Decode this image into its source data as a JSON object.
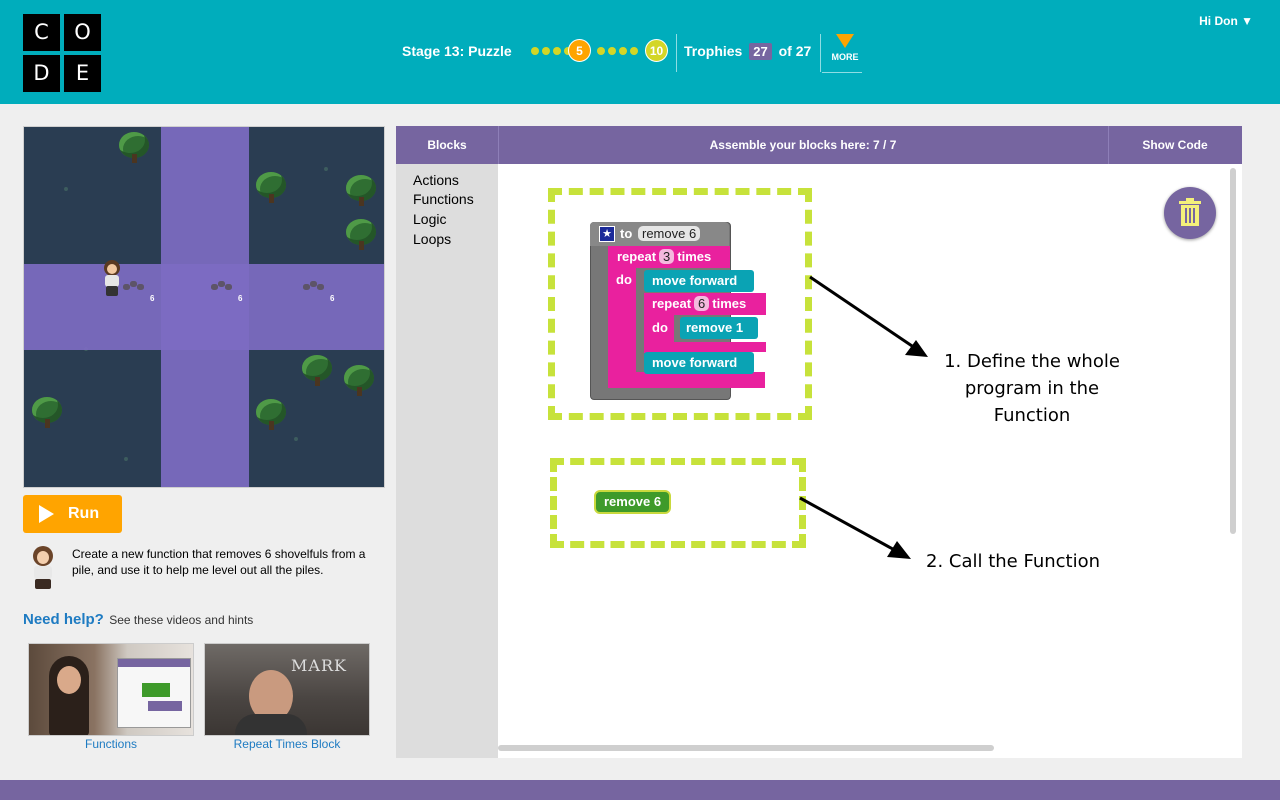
{
  "header": {
    "logo_letters": [
      "C",
      "O",
      "D",
      "E"
    ],
    "stage_label": "Stage 13: Puzzle",
    "current_puzzle": "5",
    "last_puzzle": "10",
    "trophies_label": "Trophies",
    "trophies_count": "27",
    "trophies_of": "of 27",
    "more_label": "MORE",
    "user_greeting": "Hi Don ▼",
    "colors": {
      "header_bg": "#00adbc",
      "accent_orange": "#ffa400",
      "dot_yellow": "#d3d627",
      "purple": "#7665a0"
    }
  },
  "maze": {
    "pile_count": "6",
    "character_icon": "boy-with-shovel-icon",
    "tile_color": "#7d6bc2"
  },
  "run_button": {
    "label": "Run",
    "icon": "play-icon"
  },
  "instructions": {
    "text": "Create a new function that removes 6 shovelfuls from a pile, and use it to help me level out all the piles."
  },
  "help": {
    "title": "Need help?",
    "subtitle": "See these videos and hints",
    "videos": [
      {
        "label": "Functions"
      },
      {
        "label": "Repeat Times Block"
      }
    ],
    "video2_overlay": "MARK"
  },
  "workspace": {
    "tab_blocks": "Blocks",
    "assemble_label": "Assemble your blocks here: 7 / 7",
    "show_code": "Show Code",
    "categories": [
      "Actions",
      "Functions",
      "Logic",
      "Loops"
    ],
    "blocks": {
      "def_to": "to",
      "def_name": "remove 6",
      "repeat_label": "repeat",
      "repeat_outer_count": "3",
      "times_label": "times",
      "do_label": "do",
      "move_forward": "move forward",
      "repeat_inner_count": "6",
      "remove_1": "remove 1",
      "move_forward_2": "move forward",
      "call_name": "remove 6"
    },
    "annotations": {
      "step1": "1. Define the whole program in the Function",
      "step2": "2. Call the Function"
    }
  }
}
